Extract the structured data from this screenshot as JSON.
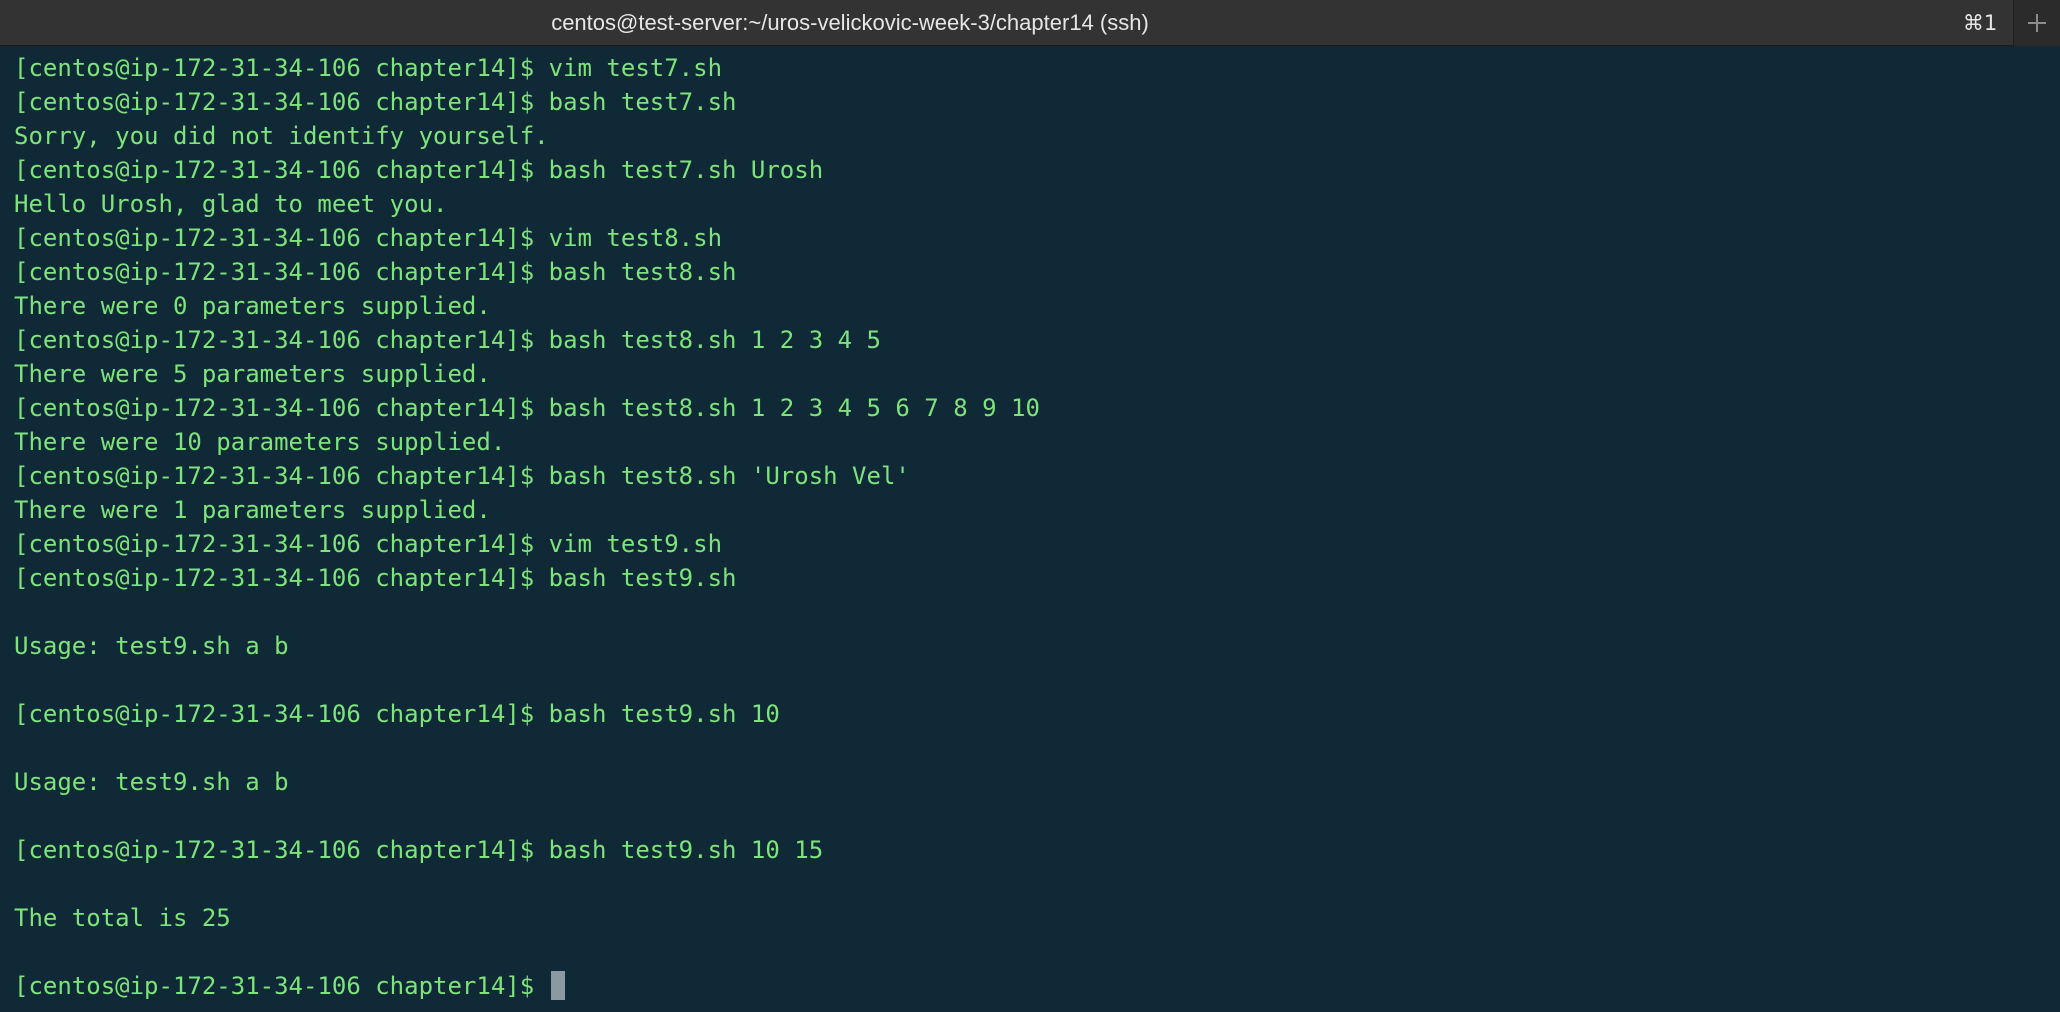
{
  "window": {
    "title": "centos@test-server:~/uros-velickovic-week-3/chapter14 (ssh)",
    "tab_shortcut": "⌘1"
  },
  "terminal": {
    "lines": [
      "[centos@ip-172-31-34-106 chapter14]$ vim test7.sh",
      "[centos@ip-172-31-34-106 chapter14]$ bash test7.sh",
      "Sorry, you did not identify yourself.",
      "[centos@ip-172-31-34-106 chapter14]$ bash test7.sh Urosh",
      "Hello Urosh, glad to meet you.",
      "[centos@ip-172-31-34-106 chapter14]$ vim test8.sh",
      "[centos@ip-172-31-34-106 chapter14]$ bash test8.sh",
      "There were 0 parameters supplied.",
      "[centos@ip-172-31-34-106 chapter14]$ bash test8.sh 1 2 3 4 5",
      "There were 5 parameters supplied.",
      "[centos@ip-172-31-34-106 chapter14]$ bash test8.sh 1 2 3 4 5 6 7 8 9 10",
      "There were 10 parameters supplied.",
      "[centos@ip-172-31-34-106 chapter14]$ bash test8.sh 'Urosh Vel'",
      "There were 1 parameters supplied.",
      "[centos@ip-172-31-34-106 chapter14]$ vim test9.sh",
      "[centos@ip-172-31-34-106 chapter14]$ bash test9.sh",
      "",
      "Usage: test9.sh a b",
      "",
      "[centos@ip-172-31-34-106 chapter14]$ bash test9.sh 10",
      "",
      "Usage: test9.sh a b",
      "",
      "[centos@ip-172-31-34-106 chapter14]$ bash test9.sh 10 15",
      "",
      "The total is 25",
      ""
    ],
    "prompt": "[centos@ip-172-31-34-106 chapter14]$ "
  }
}
